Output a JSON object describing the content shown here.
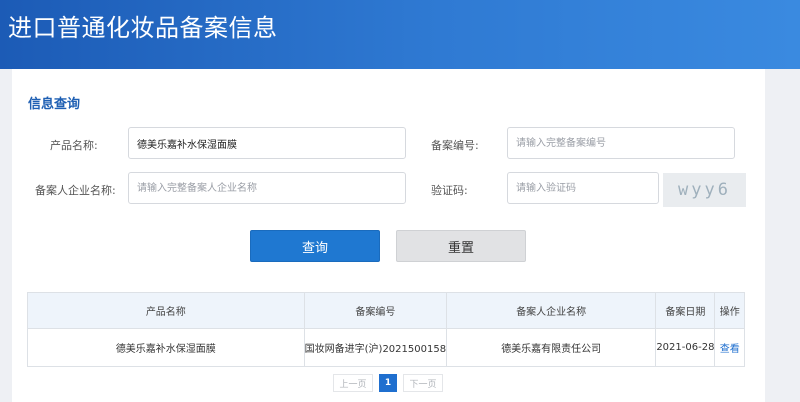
{
  "header": {
    "title": "进口普通化妆品备案信息"
  },
  "query": {
    "title": "信息查询",
    "product_name": {
      "label": "产品名称:",
      "value": "德美乐嘉补水保湿面膜",
      "placeholder": ""
    },
    "record_no": {
      "label": "备案编号:",
      "value": "",
      "placeholder": "请输入完整备案编号"
    },
    "company": {
      "label": "备案人企业名称:",
      "value": "",
      "placeholder": "请输入完整备案人企业名称"
    },
    "captcha": {
      "label": "验证码:",
      "value": "",
      "placeholder": "请输入验证码",
      "image_text": "wyy6"
    },
    "query_button": "查询",
    "reset_button": "重置"
  },
  "table": {
    "headers": [
      "产品名称",
      "备案编号",
      "备案人企业名称",
      "备案日期",
      "操作"
    ],
    "rows": [
      {
        "product": "德美乐嘉补水保湿面膜",
        "record_no": "国妆网备进字(沪)2021500158",
        "company": "德美乐嘉有限责任公司",
        "date": "2021-06-28",
        "action": "查看"
      }
    ]
  },
  "pagination": {
    "prev": "上一页",
    "current": "1",
    "next": "下一页"
  },
  "colors": {
    "header_blue": "#1c5bb6",
    "accent": "#1f78d1",
    "link": "#1f6fcf"
  }
}
